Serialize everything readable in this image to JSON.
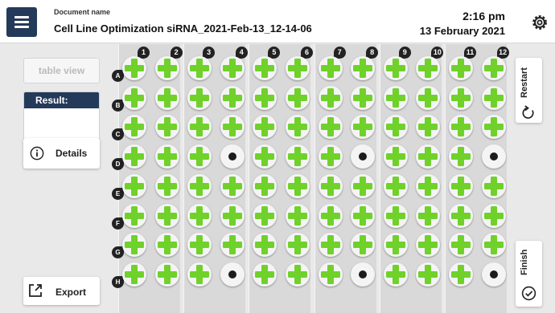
{
  "header": {
    "doc_label": "Document name",
    "doc_name": "Cell Line Optimization siRNA_2021-Feb-13_12-14-06",
    "time": "2:16 pm",
    "date": "13 February 2021"
  },
  "sidebar": {
    "table_view": "table view",
    "result_label": "Result:",
    "details_label": "Details",
    "export_label": "Export"
  },
  "actions": {
    "restart": "Restart",
    "finish": "Finish"
  },
  "plate": {
    "columns": [
      "1",
      "2",
      "3",
      "4",
      "5",
      "6",
      "7",
      "8",
      "9",
      "10",
      "11",
      "12"
    ],
    "rows": [
      "A",
      "B",
      "C",
      "D",
      "E",
      "F",
      "G",
      "H"
    ],
    "wells": [
      "++++++++++++",
      "++++++++++++",
      "++++++++++++",
      "+++o+++o+++o",
      "++++++++++++",
      "++++++++++++",
      "++++++++++++",
      "+++o+++o+++o"
    ],
    "legend": {
      "+": "plus-marked well",
      "o": "dot-marked well"
    }
  },
  "colors": {
    "accent": "#243a5a",
    "plus": "#6fd12a",
    "dot": "#1c1c1c"
  }
}
